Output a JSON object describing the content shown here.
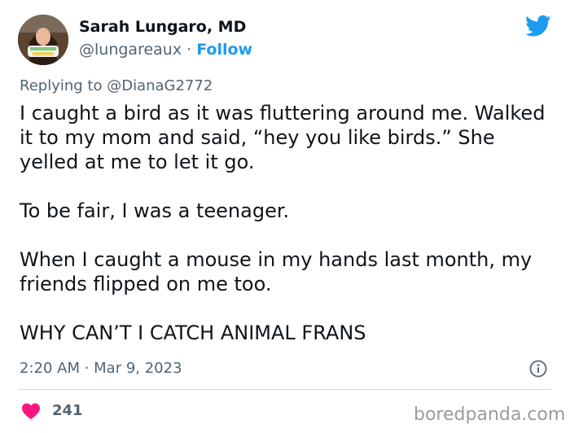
{
  "tweet": {
    "author": {
      "name": "Sarah Lungaro, MD",
      "handle": "@lungareaux",
      "separator": " · ",
      "follow_label": "Follow"
    },
    "reply_prefix": "Replying to ",
    "reply_to": "@DianaG2772",
    "paragraphs": [
      "I caught a bird as it was fluttering around me. Walked it to my mom and said, “hey you like birds.” She yelled at me to let it go.",
      "To be fair, I was a teenager.",
      "When I caught a mouse in my hands last month, my friends flipped on me too.",
      "WHY CAN’T I CATCH ANIMAL FRANS"
    ],
    "timestamp": "2:20 AM · Mar 9, 2023",
    "likes": "241"
  },
  "watermark": "boredpanda.com",
  "icons": {
    "brand": "twitter-bird-icon",
    "info": "info-icon",
    "like": "heart-icon"
  },
  "colors": {
    "link": "#1d9bf0",
    "heart": "#f91880",
    "muted": "#536471",
    "text": "#0f1419"
  }
}
